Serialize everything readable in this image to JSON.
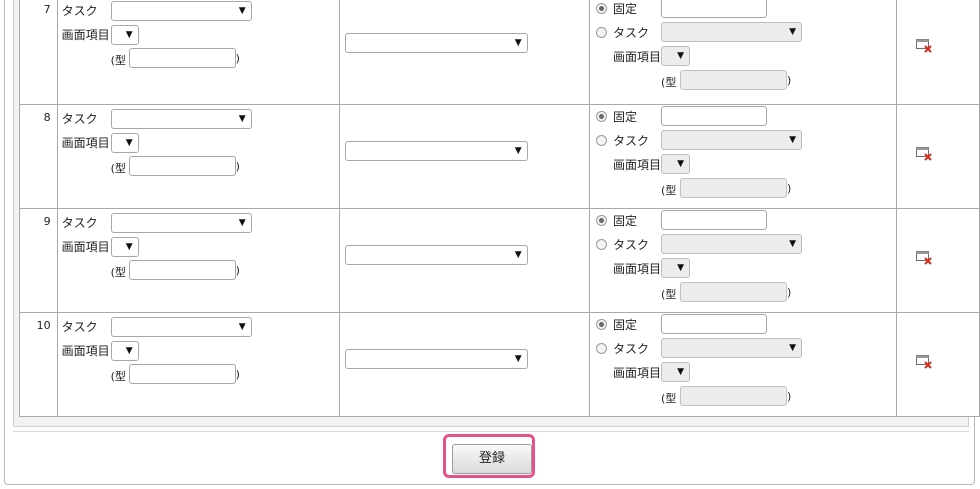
{
  "rows": [
    {
      "num": "7",
      "task_label": "タスク",
      "item_label": "画面項目",
      "type_open": "(型",
      "type_close": ")",
      "fixed_label": "固定",
      "task_radio_label": "タスク",
      "right_item_label": "画面項目",
      "right_type_open": "(型",
      "right_type_close": ")",
      "selected_mode": "fixed"
    },
    {
      "num": "8",
      "task_label": "タスク",
      "item_label": "画面項目",
      "type_open": "(型",
      "type_close": ")",
      "fixed_label": "固定",
      "task_radio_label": "タスク",
      "right_item_label": "画面項目",
      "right_type_open": "(型",
      "right_type_close": ")",
      "selected_mode": "fixed"
    },
    {
      "num": "9",
      "task_label": "タスク",
      "item_label": "画面項目",
      "type_open": "(型",
      "type_close": ")",
      "fixed_label": "固定",
      "task_radio_label": "タスク",
      "right_item_label": "画面項目",
      "right_type_open": "(型",
      "right_type_close": ")",
      "selected_mode": "fixed"
    },
    {
      "num": "10",
      "task_label": "タスク",
      "item_label": "画面項目",
      "type_open": "(型",
      "type_close": ")",
      "fixed_label": "固定",
      "task_radio_label": "タスク",
      "right_item_label": "画面項目",
      "right_type_open": "(型",
      "right_type_close": ")",
      "selected_mode": "fixed"
    }
  ],
  "icons": {
    "dropdown": "chevron-down-icon",
    "delete": "delete-row-icon"
  },
  "footer": {
    "submit_label": "登録"
  },
  "colors": {
    "highlight": "#e8508a",
    "border": "#a9a9a9"
  }
}
